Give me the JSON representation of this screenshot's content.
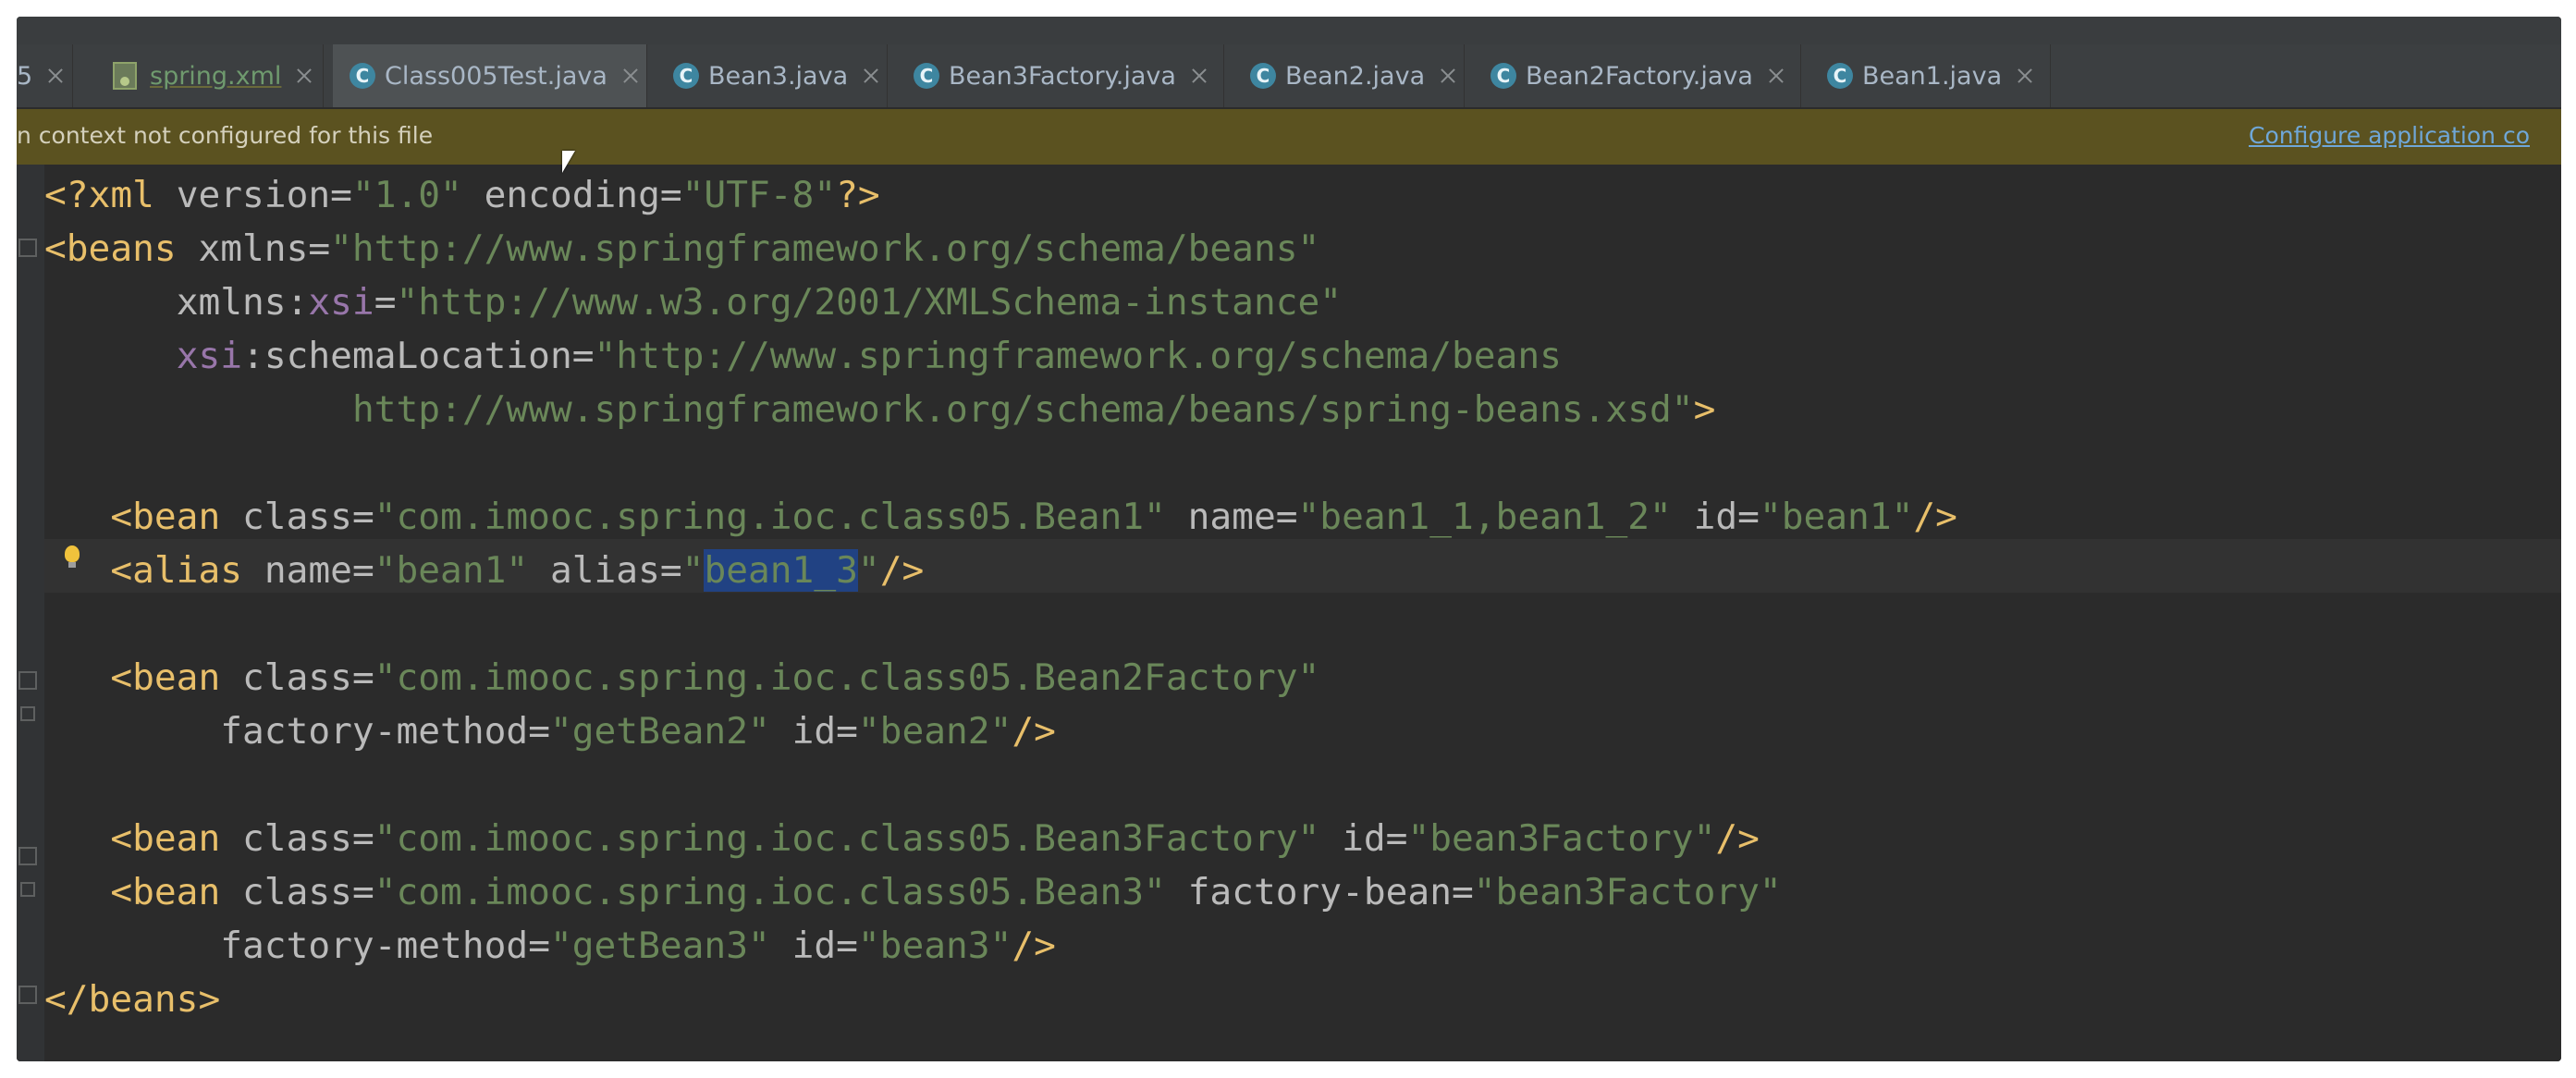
{
  "tabs": [
    {
      "label": "5",
      "type": "partial"
    },
    {
      "label": "spring.xml",
      "type": "xml"
    },
    {
      "label": "Class005Test.java",
      "type": "class",
      "active": true
    },
    {
      "label": "Bean3.java",
      "type": "class"
    },
    {
      "label": "Bean3Factory.java",
      "type": "class"
    },
    {
      "label": "Bean2.java",
      "type": "class"
    },
    {
      "label": "Bean2Factory.java",
      "type": "class"
    },
    {
      "label": "Bean1.java",
      "type": "class"
    }
  ],
  "class_icon_letter": "C",
  "banner": {
    "message": "n context not configured for this file",
    "link": "Configure application co"
  },
  "code": {
    "l1": {
      "open": "<?",
      "tag": "xml",
      "a1": "version",
      "v1": "\"1.0\"",
      "a2": "encoding",
      "v2": "\"UTF-8\"",
      "close": "?>"
    },
    "l2": {
      "tag": "<beans",
      "a1": "xmlns",
      "v1": "\"http://www.springframework.org/schema/beans\""
    },
    "l3": {
      "ns": "xmlns",
      "colon": ":",
      "local": "xsi",
      "v1": "\"http://www.w3.org/2001/XMLSchema-instance\""
    },
    "l4": {
      "ns": "xsi",
      "colon": ":",
      "local": "schemaLocation",
      "v1": "\"http://www.springframework.org/schema/beans"
    },
    "l5": {
      "v1": "http://www.springframework.org/schema/beans/spring-beans.xsd\"",
      "close": ">"
    },
    "l6": {
      "tag": "<bean",
      "a1": "class",
      "v1": "\"com.imooc.spring.ioc.class05.Bean1\"",
      "a2": "name",
      "v2": "\"bean1_1,bean1_2\"",
      "a3": "id",
      "v3": "\"bean1\"",
      "close": "/>"
    },
    "l7": {
      "tag": "<alias",
      "a1": "name",
      "v1": "\"bean1\"",
      "a2": "alias",
      "q": "\"",
      "sel": "bean1_3",
      "close": "/>"
    },
    "l8": {
      "tag": "<bean",
      "a1": "class",
      "v1": "\"com.imooc.spring.ioc.class05.Bean2Factory\""
    },
    "l9": {
      "a1": "factory-method",
      "v1": "\"getBean2\"",
      "a2": "id",
      "v2": "\"bean2\"",
      "close": "/>"
    },
    "l10": {
      "tag": "<bean",
      "a1": "class",
      "v1": "\"com.imooc.spring.ioc.class05.Bean3Factory\"",
      "a2": "id",
      "v2": "\"bean3Factory\"",
      "close": "/>"
    },
    "l11": {
      "tag": "<bean",
      "a1": "class",
      "v1": "\"com.imooc.spring.ioc.class05.Bean3\"",
      "a2": "factory-bean",
      "v2": "\"bean3Factory\""
    },
    "l12": {
      "a1": "factory-method",
      "v1": "\"getBean3\"",
      "a2": "id",
      "v2": "\"bean3\"",
      "close": "/>"
    },
    "l13": {
      "tag": "</beans>"
    }
  },
  "eq": "="
}
